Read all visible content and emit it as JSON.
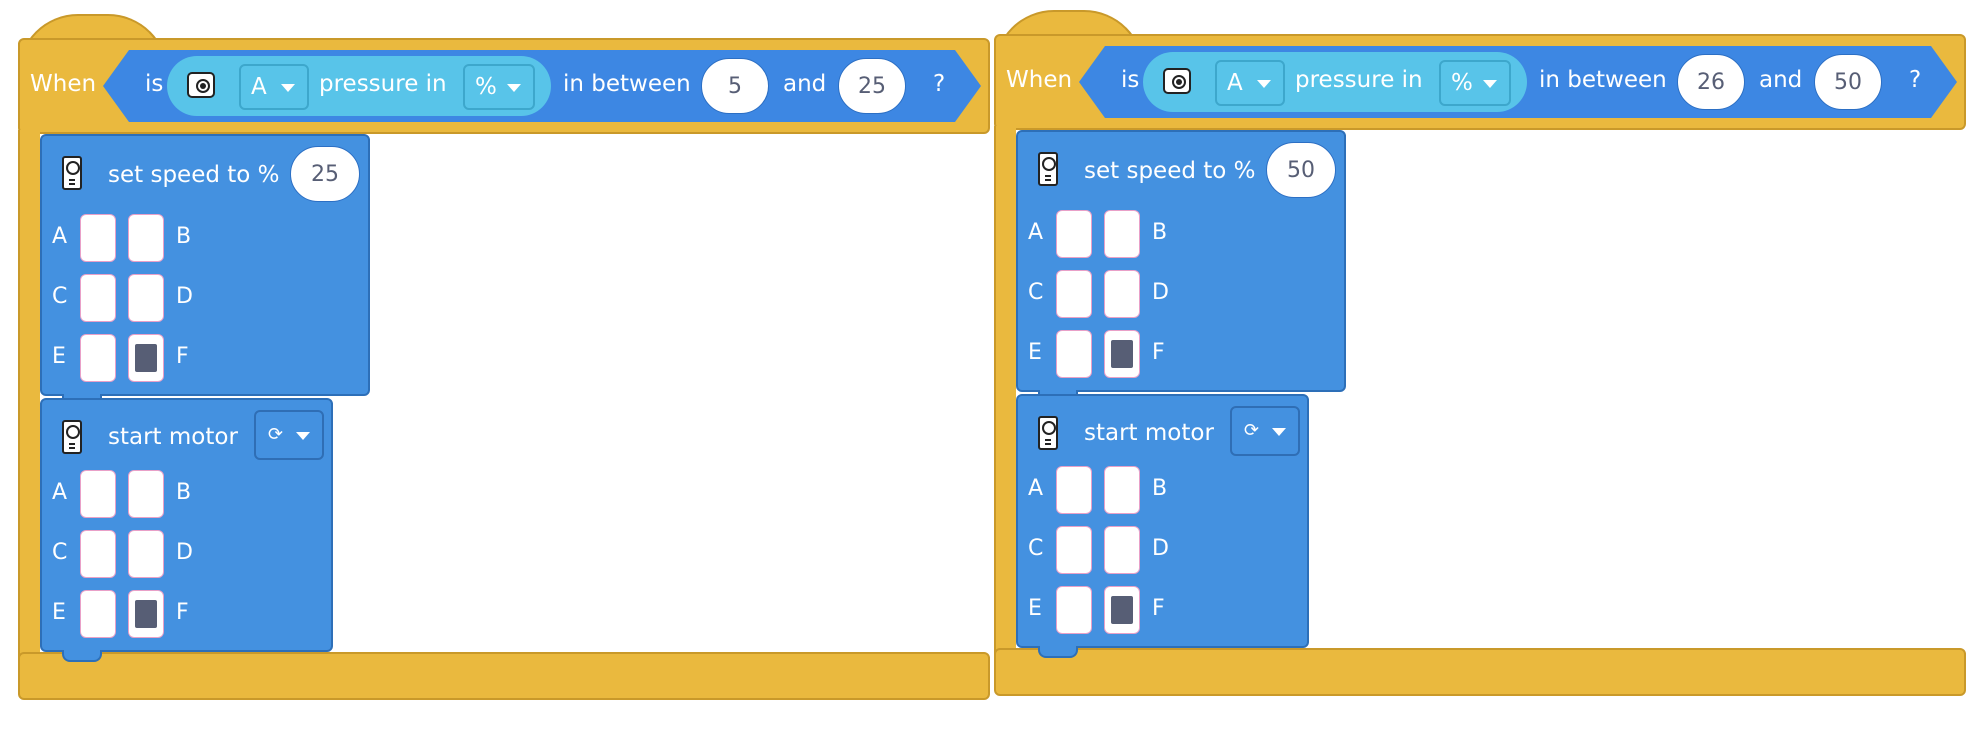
{
  "colors": {
    "event_yellow": "#EAB93E",
    "condition_blue": "#3D87E3",
    "sensor_cyan": "#58C4E9",
    "motor_blue": "#4491E0",
    "value_text": "#575E75"
  },
  "programs": [
    {
      "when_label": "When",
      "condition": {
        "is_label": "is",
        "sensor_icon": "pressure-sensor-icon",
        "port": "A",
        "pressure_label": "pressure in",
        "unit": "%",
        "in_between_label": "in between",
        "min": "5",
        "and_label": "and",
        "max": "25",
        "question_mark": "?"
      },
      "set_speed": {
        "icon": "motor-hub-icon",
        "label": "set speed to %",
        "value": "25",
        "ports": {
          "A": "A",
          "B": "B",
          "C": "C",
          "D": "D",
          "E": "E",
          "F": "F"
        },
        "selected": [
          "F"
        ]
      },
      "start_motor": {
        "icon": "motor-hub-icon",
        "label": "start motor",
        "direction_glyph": "⟳",
        "ports": {
          "A": "A",
          "B": "B",
          "C": "C",
          "D": "D",
          "E": "E",
          "F": "F"
        },
        "selected": [
          "F"
        ]
      }
    },
    {
      "when_label": "When",
      "condition": {
        "is_label": "is",
        "sensor_icon": "pressure-sensor-icon",
        "port": "A",
        "pressure_label": "pressure in",
        "unit": "%",
        "in_between_label": "in between",
        "min": "26",
        "and_label": "and",
        "max": "50",
        "question_mark": "?"
      },
      "set_speed": {
        "icon": "motor-hub-icon",
        "label": "set speed to %",
        "value": "50",
        "ports": {
          "A": "A",
          "B": "B",
          "C": "C",
          "D": "D",
          "E": "E",
          "F": "F"
        },
        "selected": [
          "F"
        ]
      },
      "start_motor": {
        "icon": "motor-hub-icon",
        "label": "start motor",
        "direction_glyph": "⟳",
        "ports": {
          "A": "A",
          "B": "B",
          "C": "C",
          "D": "D",
          "E": "E",
          "F": "F"
        },
        "selected": [
          "F"
        ]
      }
    }
  ]
}
